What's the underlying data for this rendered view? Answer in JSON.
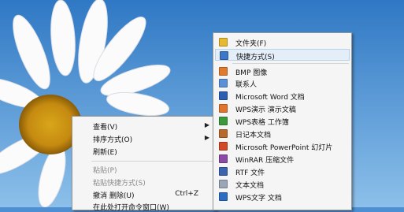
{
  "context_menu": {
    "view": "查看(V)",
    "sort_by": "排序方式(O)",
    "refresh": "刷新(E)",
    "paste": "粘贴(P)",
    "paste_shortcut": "粘贴快捷方式(S)",
    "undo_delete": "撤消 删除(U)",
    "undo_shortcut": "Ctrl+Z",
    "open_command_window": "在此处打开命令窗口(W)"
  },
  "new_submenu": {
    "items": [
      {
        "label": "文件夹(F)",
        "icon": "folder-icon",
        "color": "#e8b830"
      },
      {
        "label": "快捷方式(S)",
        "icon": "shortcut-icon",
        "color": "#3c78c8"
      },
      {
        "label": "BMP 图像",
        "icon": "bmp-image-icon",
        "color": "#e07a2c"
      },
      {
        "label": "联系人",
        "icon": "contact-icon",
        "color": "#5a90d8"
      },
      {
        "label": "Microsoft Word 文档",
        "icon": "word-document-icon",
        "color": "#2b5fb4"
      },
      {
        "label": "WPS演示 演示文稿",
        "icon": "wps-presentation-icon",
        "color": "#e0742a"
      },
      {
        "label": "WPS表格 工作簿",
        "icon": "wps-spreadsheet-icon",
        "color": "#3c9a3c"
      },
      {
        "label": "日记本文档",
        "icon": "journal-icon",
        "color": "#b86a2c"
      },
      {
        "label": "Microsoft PowerPoint 幻灯片",
        "icon": "powerpoint-icon",
        "color": "#d24a26"
      },
      {
        "label": "WinRAR 压缩文件",
        "icon": "winrar-icon",
        "color": "#8a4aa6"
      },
      {
        "label": "RTF 文件",
        "icon": "rtf-file-icon",
        "color": "#3a64b0"
      },
      {
        "label": "文本文档",
        "icon": "text-document-icon",
        "color": "#9aa6b8"
      },
      {
        "label": "WPS文字 文档",
        "icon": "wps-writer-icon",
        "color": "#2b6cc4"
      }
    ]
  }
}
